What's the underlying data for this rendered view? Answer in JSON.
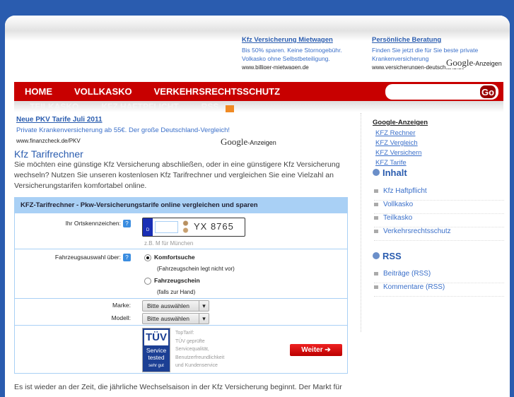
{
  "top_ads": [
    {
      "title": "Kfz Versicherung Mietwagen",
      "line1": "Bis 50% sparen. Keine Stornogebühr.",
      "line2": "Volkasko ohne Selbstbeteiligung.",
      "url": "www.billiger-mietwagen.de"
    },
    {
      "title": "Persönliche Beratung",
      "line1": "Finden Sie jetzt die für Sie beste private",
      "line2": "Krankenversicherung",
      "url": "www.versicherungen-deutschland.de"
    }
  ],
  "google_logo": "Google",
  "google_suffix": "-Anzeigen",
  "nav": [
    "HOME",
    "VOLLKASKO",
    "VERKEHRSRECHTSSCHUTZ"
  ],
  "nav2": [
    "TEILKASKO",
    "KFZ HAFTPFLICHT",
    "RSS"
  ],
  "search": {
    "value": "",
    "button": "Go"
  },
  "main_ad": {
    "title": "Neue PKV Tarife Juli 2011",
    "text": "Private Krankenversicherung ab 55€. Der große Deutschland-Vergleich!",
    "url": "www.finanzcheck.de/PKV"
  },
  "heading": "Kfz Tarifrechner",
  "intro": "Sie möchten eine günstige Kfz Versicherung abschließen, oder in eine günstigere Kfz Versicherung wechseln? Nutzen Sie unseren kostenlosen Kfz Tarifrechner  und vergleichen Sie eine Vielzahl an Versicherungstarifen komfortabel online.",
  "form": {
    "title": "KFZ-Tarifrechner - Pkw-Versicherungstarife online vergleichen und sparen",
    "plate_label": "Ihr Ortskennzeichen:",
    "plate_country": "D",
    "plate_value": "",
    "plate_number": "YX  8765",
    "plate_hint": "z.B. M für München",
    "vehicle_label": "Fahrzeugsauswahl über:",
    "opt1": "Komfortsuche",
    "opt1_sub": "(Fahrzeugschein legt nicht vor)",
    "opt2": "Fahrzeugschein",
    "opt2_sub": "(falls zur Hand)",
    "brand_label": "Marke:",
    "brand_value": "Bitte auswählen",
    "model_label": "Modell:",
    "model_value": "Bitte auswählen",
    "tuv_top": "TÜV",
    "tuv_mid": "Service tested",
    "tuv_bottom": "sehr gut",
    "tuv_text": [
      "TopTarif:",
      "TÜV geprüfte",
      "Servicequalität,",
      "Benutzerfreundlichkeit",
      "und Kundenservice"
    ],
    "submit": "Weiter ➔"
  },
  "footer_text": "Es ist wieder an der Zeit, die jährliche Wechselsaison in der Kfz Versicherung beginnt. Der Markt für",
  "sidebar": {
    "ads_title": "Google-Anzeigen",
    "ads": [
      "KFZ Rechner",
      "KFZ Vergleich",
      "KFZ Versichern",
      "KFZ Tarife"
    ],
    "inhalt_title": "Inhalt",
    "inhalt": [
      "Kfz Haftpflicht",
      "Vollkasko",
      "Teilkasko",
      "Verkehrsrechtsschutz"
    ],
    "rss_title": "RSS",
    "rss": [
      "Beiträge (RSS)",
      "Kommentare (RSS)"
    ]
  }
}
